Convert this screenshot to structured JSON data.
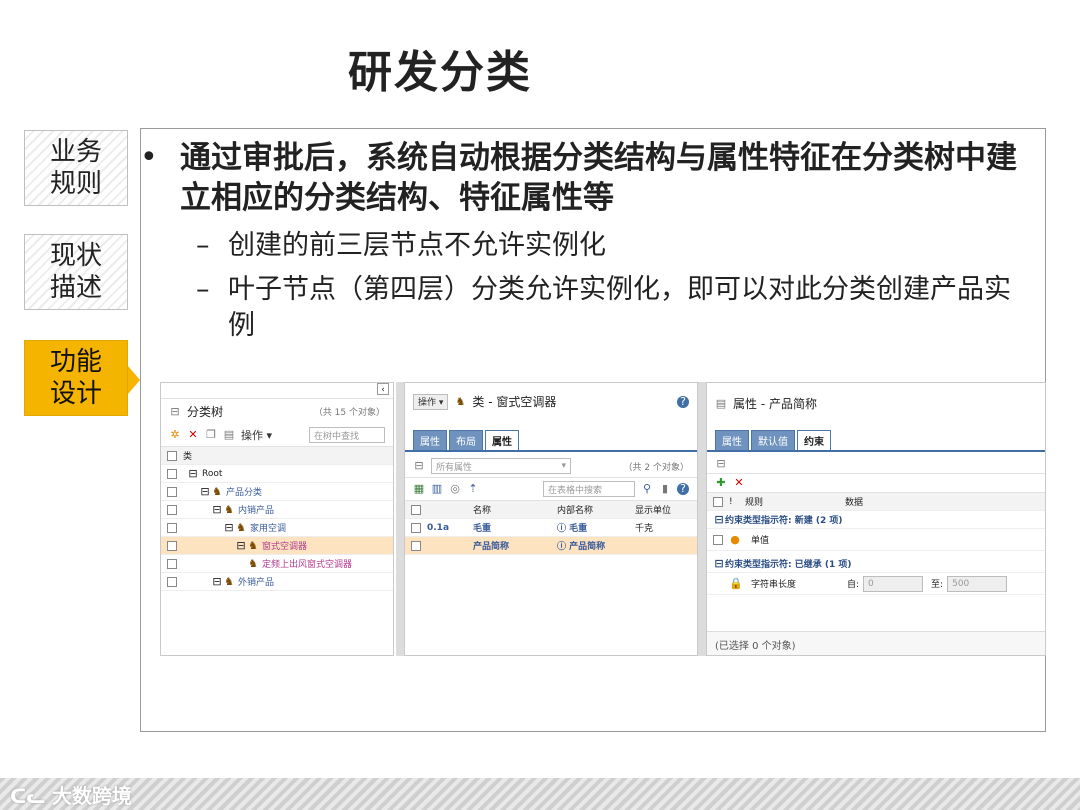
{
  "slide": {
    "title": "研发分类",
    "side_tabs": [
      {
        "line1": "业务",
        "line2": "规则",
        "active": false
      },
      {
        "line1": "现状",
        "line2": "描述",
        "active": false
      },
      {
        "line1": "功能",
        "line2": "设计",
        "active": true
      }
    ],
    "bullet": "•",
    "main_point": "通过审批后，系统自动根据分类结构与属性特征在分类树中建立相应的分类结构、特征属性等",
    "sub_dash": "–",
    "sub_points": [
      "创建的前三层节点不允许实例化",
      "叶子节点（第四层）分类允许实例化，即可以对此分类创建产品实例"
    ]
  },
  "tree_panel": {
    "title": "分类树",
    "count": "（共 15 个对象）",
    "operate": "操作 ▾",
    "search_placeholder": "在树中查找",
    "header": "类",
    "rows": [
      {
        "label": "Root",
        "indent": 0,
        "style": "plain"
      },
      {
        "label": "产品分类",
        "indent": 1,
        "style": "blue"
      },
      {
        "label": "内销产品",
        "indent": 2,
        "style": "blue"
      },
      {
        "label": "家用空调",
        "indent": 3,
        "style": "blue"
      },
      {
        "label": "窗式空调器",
        "indent": 4,
        "style": "pink"
      },
      {
        "label": "定频上出风窗式空调器",
        "indent": 5,
        "style": "pink"
      },
      {
        "label": "外销产品",
        "indent": 2,
        "style": "blue"
      }
    ]
  },
  "class_panel": {
    "operate": "操作 ▾",
    "title": "类 - 窗式空调器",
    "help": "?",
    "tabs": [
      "属性",
      "布局",
      "属性"
    ],
    "active_tab": 2,
    "filter": "所有属性",
    "count": "（共 2 个对象）",
    "search_placeholder": "在表格中搜索",
    "columns": [
      "名称",
      "内部名称",
      "显示单位"
    ],
    "rows": [
      {
        "icon": "0.1a",
        "name": "毛重",
        "internal": "毛重",
        "unit": "千克",
        "selected": false
      },
      {
        "icon": "",
        "name": "产品简称",
        "internal": "产品简称",
        "unit": "",
        "selected": true
      }
    ]
  },
  "attr_panel": {
    "title": "属性 - 产品简称",
    "tabs": [
      "属性",
      "默认值",
      "约束"
    ],
    "active_tab": 2,
    "columns": [
      "!",
      "规则",
      "数据"
    ],
    "group1": "约束类型指示符: 新建 (2 项)",
    "group1_row": "单值",
    "group2": "约束类型指示符: 已继承 (1 项)",
    "group2_row": "字符串长度",
    "from_label": "自:",
    "from_value": "0",
    "to_label": "至:",
    "to_value": "500",
    "footer": "(已选择 0 个对象)"
  },
  "brand": {
    "logo_text": "大数跨境"
  }
}
